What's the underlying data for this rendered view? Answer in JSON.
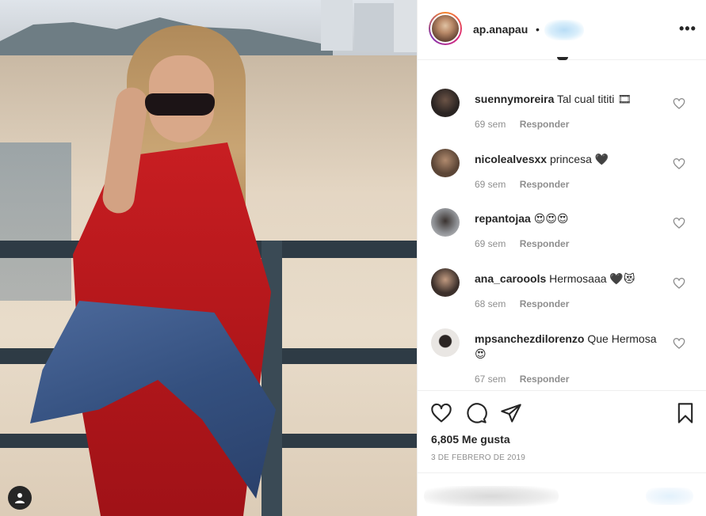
{
  "post": {
    "username": "ap.anapau",
    "separator": "•",
    "more_label": "•••",
    "likes_label": "6,805 Me gusta",
    "date_label": "3 DE FEBRERO DE 2019"
  },
  "comments": [
    {
      "user": "suennymoreira",
      "text": "Tal cual tititi 🎞",
      "time": "69 sem",
      "reply": "Responder",
      "avatar_color": "#2a2422"
    },
    {
      "user": "nicolealvesxx",
      "text": "princesa 🖤",
      "time": "69 sem",
      "reply": "Responder",
      "avatar_color": "#5b4536"
    },
    {
      "user": "repantojaa",
      "text": "😍😍😍",
      "time": "69 sem",
      "reply": "Responder",
      "avatar_color": "#8d8f93"
    },
    {
      "user": "ana_caroools",
      "text": "Hermosaaa 🖤😻",
      "time": "68 sem",
      "reply": "Responder",
      "avatar_color": "#3c302b"
    },
    {
      "user": "mpsanchezdilorenzo",
      "text": "Que Hermosa 😍",
      "time": "67 sem",
      "reply": "Responder",
      "avatar_color": "#e9e6e3"
    }
  ],
  "icons": {
    "like": "heart-icon",
    "comment": "speech-bubble-icon",
    "share": "paper-plane-icon",
    "save": "bookmark-icon",
    "comment_like": "small-heart-icon",
    "photo_tag": "user-tag-icon"
  },
  "colors": {
    "text": "#262626",
    "muted": "#8e8e8e",
    "border": "#efefef",
    "story_ring": [
      "#f58529",
      "#dd2a7b",
      "#8134af"
    ]
  }
}
